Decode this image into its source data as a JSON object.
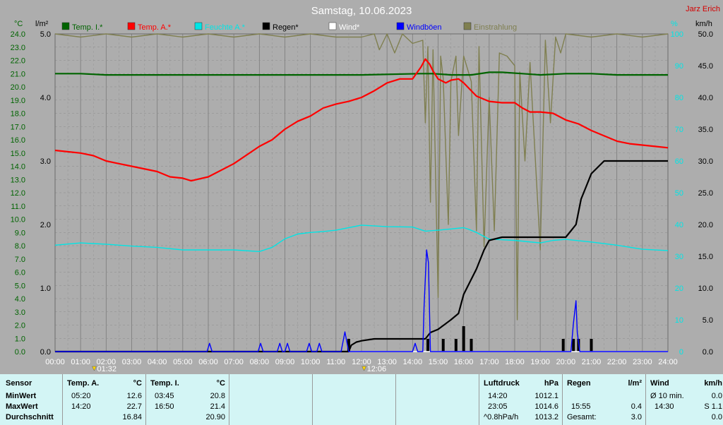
{
  "header": {
    "title": "Samstag, 10.06.2023",
    "author": "Jarz Erich"
  },
  "chart_data": {
    "type": "line",
    "title": "Samstag, 10.06.2023",
    "x": [
      "00:00",
      "01:00",
      "02:00",
      "03:00",
      "04:00",
      "05:00",
      "06:00",
      "07:00",
      "08:00",
      "09:00",
      "10:00",
      "11:00",
      "12:00",
      "13:00",
      "14:00",
      "15:00",
      "16:00",
      "17:00",
      "18:00",
      "19:00",
      "20:00",
      "21:00",
      "22:00",
      "23:00",
      "24:00"
    ],
    "x_markers": [
      "01:32",
      "12:06"
    ],
    "axes": {
      "temp_unit": "°C",
      "temp_ticks": [
        "0.0",
        "1.0",
        "2.0",
        "3.0",
        "4.0",
        "5.0",
        "6.0",
        "7.0",
        "8.0",
        "9.0",
        "10.0",
        "11.0",
        "12.0",
        "13.0",
        "14.0",
        "15.0",
        "16.0",
        "17.0",
        "18.0",
        "19.0",
        "20.0",
        "21.0",
        "22.0",
        "23.0",
        "24.0"
      ],
      "rain_unit": "l/m²",
      "rain_ticks": [
        "0.0",
        "1.0",
        "2.0",
        "3.0",
        "4.0",
        "5.0"
      ],
      "hum_unit": "%",
      "hum_ticks": [
        "0",
        "10",
        "20",
        "30",
        "40",
        "50",
        "60",
        "70",
        "80",
        "90",
        "100"
      ],
      "wind_unit": "km/h",
      "wind_ticks": [
        "0.0",
        "5.0",
        "10.0",
        "15.0",
        "20.0",
        "25.0",
        "30.0",
        "35.0",
        "40.0",
        "45.0",
        "50.0"
      ]
    },
    "grid": true,
    "legend_position": "top",
    "series": [
      {
        "name": "Temp. I.*",
        "color": "#006400",
        "axis": "temp",
        "points": [
          [
            0,
            21.0
          ],
          [
            1,
            21.0
          ],
          [
            2,
            20.9
          ],
          [
            4,
            20.9
          ],
          [
            8,
            20.9
          ],
          [
            12,
            20.9
          ],
          [
            14.3,
            21.0
          ],
          [
            14.8,
            21.0
          ],
          [
            15.5,
            20.9
          ],
          [
            16.3,
            20.9
          ],
          [
            17,
            21.1
          ],
          [
            17.5,
            21.1
          ],
          [
            18.3,
            21.0
          ],
          [
            19,
            20.9
          ],
          [
            20,
            21.0
          ],
          [
            21,
            21.0
          ],
          [
            22,
            20.9
          ],
          [
            24,
            20.9
          ]
        ]
      },
      {
        "name": "Temp. A.*",
        "color": "#ff0000",
        "axis": "temp",
        "points": [
          [
            0,
            15.2
          ],
          [
            1,
            15.0
          ],
          [
            1.5,
            14.8
          ],
          [
            2,
            14.4
          ],
          [
            2.5,
            14.2
          ],
          [
            3,
            14.0
          ],
          [
            4,
            13.6
          ],
          [
            4.5,
            13.2
          ],
          [
            5,
            13.1
          ],
          [
            5.33,
            12.9
          ],
          [
            6,
            13.2
          ],
          [
            7,
            14.2
          ],
          [
            8,
            15.5
          ],
          [
            8.5,
            16.0
          ],
          [
            9,
            16.8
          ],
          [
            9.5,
            17.4
          ],
          [
            10,
            17.8
          ],
          [
            10.5,
            18.4
          ],
          [
            11,
            18.7
          ],
          [
            11.5,
            18.9
          ],
          [
            12,
            19.2
          ],
          [
            12.5,
            19.7
          ],
          [
            13,
            20.3
          ],
          [
            13.5,
            20.6
          ],
          [
            14,
            20.6
          ],
          [
            14.33,
            21.5
          ],
          [
            14.5,
            22.1
          ],
          [
            14.67,
            21.7
          ],
          [
            14.8,
            21.2
          ],
          [
            15,
            20.6
          ],
          [
            15.3,
            20.3
          ],
          [
            15.5,
            20.5
          ],
          [
            15.8,
            20.6
          ],
          [
            16,
            20.3
          ],
          [
            16.5,
            19.3
          ],
          [
            17,
            18.9
          ],
          [
            17.5,
            18.8
          ],
          [
            18,
            18.8
          ],
          [
            18.3,
            18.4
          ],
          [
            18.6,
            18.1
          ],
          [
            19,
            18.1
          ],
          [
            19.5,
            18.0
          ],
          [
            20,
            17.5
          ],
          [
            20.5,
            17.2
          ],
          [
            21,
            16.7
          ],
          [
            21.5,
            16.3
          ],
          [
            22,
            15.9
          ],
          [
            22.5,
            15.7
          ],
          [
            23,
            15.6
          ],
          [
            23.5,
            15.5
          ],
          [
            24,
            15.4
          ]
        ]
      },
      {
        "name": "Feuchte A.*",
        "color": "#00e5e5",
        "axis": "hum",
        "points": [
          [
            0,
            33.5
          ],
          [
            1,
            34.2
          ],
          [
            2,
            33.8
          ],
          [
            3,
            33.2
          ],
          [
            4,
            32.8
          ],
          [
            5,
            32.0
          ],
          [
            6,
            32.0
          ],
          [
            7,
            32.0
          ],
          [
            8,
            31.5
          ],
          [
            8.5,
            32.8
          ],
          [
            9,
            35.5
          ],
          [
            9.5,
            37.0
          ],
          [
            10,
            37.5
          ],
          [
            10.5,
            37.8
          ],
          [
            11,
            38.2
          ],
          [
            12,
            39.8
          ],
          [
            13,
            39.3
          ],
          [
            14,
            39.2
          ],
          [
            14.5,
            37.9
          ],
          [
            15,
            38.2
          ],
          [
            16,
            39.0
          ],
          [
            16.2,
            38.5
          ],
          [
            16.5,
            37.5
          ],
          [
            17,
            35.4
          ],
          [
            18,
            35.0
          ],
          [
            19,
            34.2
          ],
          [
            19.5,
            35.0
          ],
          [
            20,
            35.3
          ],
          [
            21,
            34.5
          ],
          [
            22,
            33.5
          ],
          [
            23,
            32.2
          ],
          [
            24,
            31.8
          ]
        ]
      },
      {
        "name": "Regen*",
        "color": "#000000",
        "axis": "rain",
        "points": [
          [
            0,
            0
          ],
          [
            11.5,
            0
          ],
          [
            11.6,
            0.1
          ],
          [
            11.8,
            0.15
          ],
          [
            12,
            0.17
          ],
          [
            12.5,
            0.2
          ],
          [
            13.5,
            0.2
          ],
          [
            14.5,
            0.2
          ],
          [
            14.7,
            0.3
          ],
          [
            15,
            0.35
          ],
          [
            15.5,
            0.5
          ],
          [
            15.8,
            0.6
          ],
          [
            16,
            0.9
          ],
          [
            16.5,
            1.3
          ],
          [
            16.8,
            1.6
          ],
          [
            17,
            1.75
          ],
          [
            17.5,
            1.8
          ],
          [
            19.5,
            1.8
          ],
          [
            20,
            1.8
          ],
          [
            20.2,
            1.9
          ],
          [
            20.4,
            2.0
          ],
          [
            20.6,
            2.4
          ],
          [
            20.8,
            2.6
          ],
          [
            21,
            2.8
          ],
          [
            21.5,
            3.0
          ],
          [
            24,
            3.0
          ]
        ]
      },
      {
        "name": "Wind*",
        "color": "#ffffff",
        "axis": "wind",
        "points": [
          [
            0,
            0
          ],
          [
            24,
            0
          ]
        ]
      },
      {
        "name": "Windböen",
        "color": "#0000ff",
        "axis": "wind",
        "points": [
          [
            0,
            0
          ],
          [
            5.95,
            0
          ],
          [
            6.05,
            1.3
          ],
          [
            6.15,
            0
          ],
          [
            7.95,
            0
          ],
          [
            8.05,
            1.3
          ],
          [
            8.15,
            0
          ],
          [
            8.7,
            0
          ],
          [
            8.8,
            1.3
          ],
          [
            8.9,
            0
          ],
          [
            9.0,
            0
          ],
          [
            9.1,
            1.3
          ],
          [
            9.2,
            0
          ],
          [
            9.85,
            0
          ],
          [
            9.95,
            1.3
          ],
          [
            10.05,
            0
          ],
          [
            10.25,
            0
          ],
          [
            10.35,
            1.3
          ],
          [
            10.45,
            0
          ],
          [
            11.2,
            0
          ],
          [
            11.35,
            3.1
          ],
          [
            11.5,
            0
          ],
          [
            14.0,
            0
          ],
          [
            14.1,
            1.3
          ],
          [
            14.2,
            0
          ],
          [
            14.4,
            0
          ],
          [
            14.45,
            7.0
          ],
          [
            14.55,
            16.0
          ],
          [
            14.62,
            14.0
          ],
          [
            14.7,
            0
          ],
          [
            20.2,
            0
          ],
          [
            20.3,
            4.5
          ],
          [
            20.4,
            8.0
          ],
          [
            20.45,
            3.0
          ],
          [
            20.55,
            0
          ],
          [
            24,
            0
          ]
        ]
      },
      {
        "name": "Einstrahlung",
        "color": "#7f7f50",
        "axis": "hum",
        "points": [
          [
            0,
            100
          ],
          [
            1,
            99
          ],
          [
            2,
            100
          ],
          [
            3,
            99
          ],
          [
            4,
            100
          ],
          [
            5,
            99
          ],
          [
            6,
            100
          ],
          [
            7,
            99
          ],
          [
            8,
            100
          ],
          [
            9,
            99
          ],
          [
            10,
            100
          ],
          [
            11,
            99
          ],
          [
            12,
            99
          ],
          [
            12.5,
            100
          ],
          [
            12.7,
            95
          ],
          [
            13,
            100
          ],
          [
            13.3,
            94
          ],
          [
            13.6,
            100
          ],
          [
            14,
            97
          ],
          [
            14.4,
            98
          ],
          [
            14.5,
            72
          ],
          [
            14.6,
            96
          ],
          [
            14.7,
            47
          ],
          [
            14.8,
            95
          ],
          [
            15.0,
            17
          ],
          [
            15.1,
            93
          ],
          [
            15.2,
            86
          ],
          [
            15.4,
            40
          ],
          [
            15.5,
            85
          ],
          [
            15.7,
            93
          ],
          [
            15.8,
            68
          ],
          [
            16.0,
            93
          ],
          [
            16.3,
            85
          ],
          [
            16.5,
            38
          ],
          [
            16.6,
            96
          ],
          [
            16.8,
            33
          ],
          [
            17.0,
            80
          ],
          [
            17.2,
            38
          ],
          [
            17.4,
            94
          ],
          [
            17.7,
            93
          ],
          [
            18.0,
            90
          ],
          [
            18.1,
            10
          ],
          [
            18.2,
            88
          ],
          [
            18.4,
            60
          ],
          [
            18.6,
            91
          ],
          [
            19.0,
            32
          ],
          [
            19.2,
            98
          ],
          [
            19.4,
            72
          ],
          [
            19.6,
            99
          ],
          [
            19.8,
            94
          ],
          [
            20,
            100
          ],
          [
            21,
            99
          ],
          [
            22,
            100
          ],
          [
            23,
            99
          ],
          [
            24,
            100
          ]
        ]
      }
    ],
    "bars": {
      "name": "Regen*",
      "color": "#000000",
      "axis": "rain",
      "points": [
        [
          11.5,
          0.2
        ],
        [
          14.6,
          0.2
        ],
        [
          15.2,
          0.2
        ],
        [
          15.7,
          0.2
        ],
        [
          16.0,
          0.4
        ],
        [
          16.3,
          0.2
        ],
        [
          19.9,
          0.2
        ],
        [
          20.3,
          0.2
        ],
        [
          20.5,
          0.2
        ],
        [
          21.0,
          0.2
        ]
      ]
    }
  },
  "stats": {
    "sensor": {
      "header": "Sensor",
      "min": "MinWert",
      "max": "MaxWert",
      "avg": "Durchschnitt"
    },
    "temp_a": {
      "header": "Temp. A.",
      "unit": "°C",
      "min_time": "05:20",
      "min_val": "12.6",
      "max_time": "14:20",
      "max_val": "22.7",
      "avg": "16.84"
    },
    "temp_i": {
      "header": "Temp. I.",
      "unit": "°C",
      "min_time": "03:45",
      "min_val": "20.8",
      "max_time": "16:50",
      "max_val": "21.4",
      "avg": "20.90"
    },
    "pressure": {
      "header": "Luftdruck",
      "unit": "hPa",
      "r1_time": "14:20",
      "r1_val": "1012.1",
      "r2_time": "23:05",
      "r2_val": "1014.6",
      "r3_label": "^0.8hPa/h",
      "r3_val": "1013.2"
    },
    "rain": {
      "header": "Regen",
      "unit": "l/m²",
      "r2_time": "15:55",
      "r2_val": "0.4",
      "total_label": "Gesamt:",
      "total_val": "3.0"
    },
    "wind": {
      "header": "Wind",
      "unit": "km/h",
      "r1_label": "Ø 10 min.",
      "r1_val": "0.0",
      "r2_time": "14:30",
      "r2_val": "S 1.1",
      "r3_val": "0.0"
    }
  }
}
